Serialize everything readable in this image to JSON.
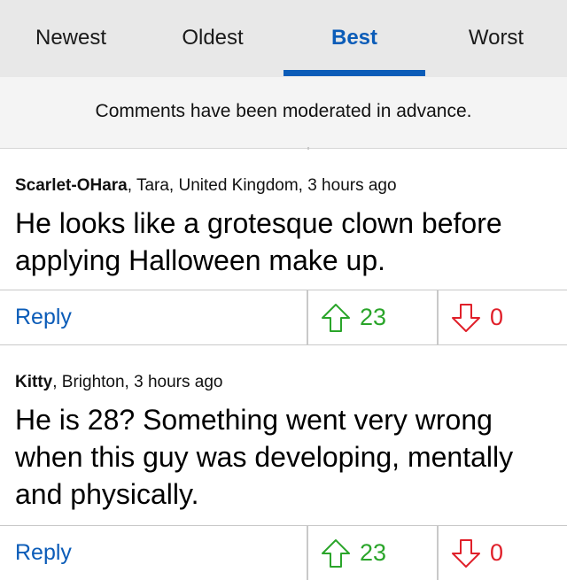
{
  "tabs": [
    {
      "label": "Newest"
    },
    {
      "label": "Oldest"
    },
    {
      "label": "Best"
    },
    {
      "label": "Worst"
    }
  ],
  "active_tab": "Best",
  "notice": "Comments have been moderated in advance.",
  "comments": [
    {
      "author": "Scarlet-OHara",
      "location": ", Tara, United Kingdom, 3 hours ago",
      "body": "He looks like a grotesque clown before applying Halloween make up.",
      "reply_label": "Reply",
      "upvotes": "23",
      "downvotes": "0"
    },
    {
      "author": "Kitty",
      "location": ", Brighton, 3 hours ago",
      "body": "He is 28? Something went very wrong when this guy was developing, mentally and physically.",
      "reply_label": "Reply",
      "upvotes": "23",
      "downvotes": "0"
    }
  ],
  "colors": {
    "accent": "#0b5cb8",
    "upvote": "#2aa52a",
    "downvote": "#e0202a",
    "tab_bar": "#e8e8e8"
  },
  "icons": {
    "upvote": "arrow-up-icon",
    "downvote": "arrow-down-icon"
  }
}
